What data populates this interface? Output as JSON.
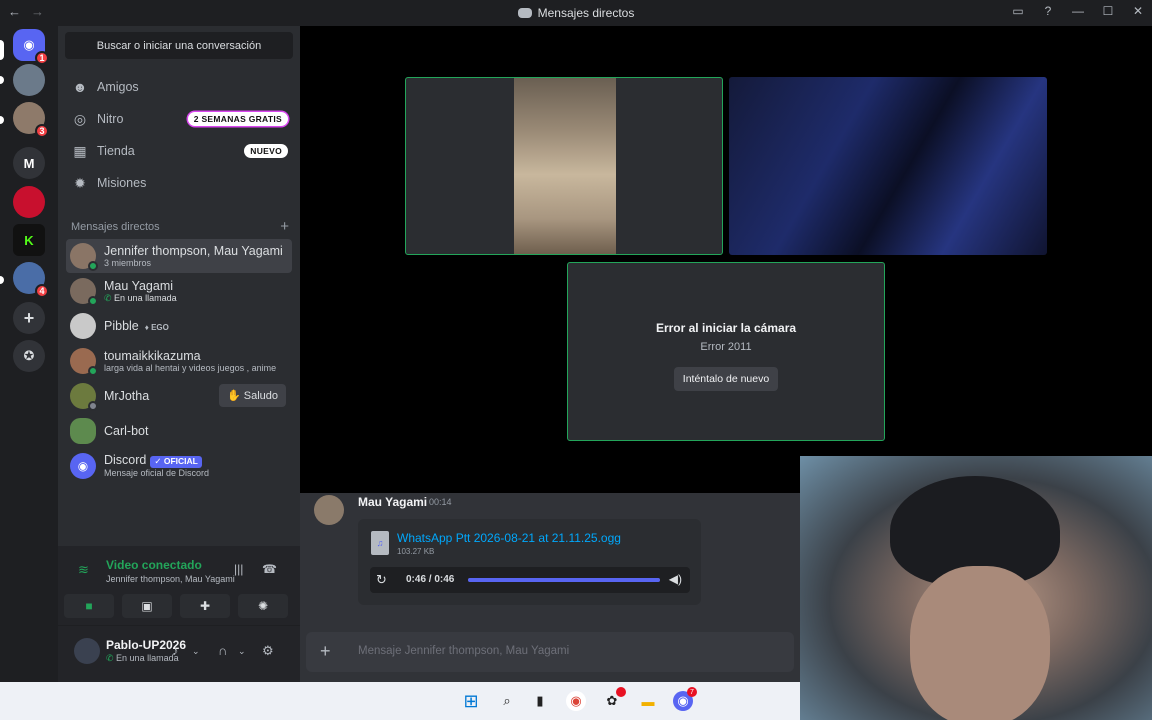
{
  "window": {
    "title": "Mensajes directos",
    "back": "←",
    "forward": "→"
  },
  "servers": [
    {
      "name": "Direct messages",
      "badge": "1"
    },
    {
      "name": "Group server"
    },
    {
      "name": "Server",
      "badge": "3"
    },
    {
      "name": "M"
    },
    {
      "name": "Server red"
    },
    {
      "name": "Kick"
    },
    {
      "name": "Server game",
      "badge": "4"
    }
  ],
  "dm_panel": {
    "search_placeholder": "Buscar o iniciar una conversación",
    "nav": [
      {
        "label": "Amigos"
      },
      {
        "label": "Nitro",
        "tag": "2 SEMANAS GRATIS"
      },
      {
        "label": "Tienda",
        "tag": "NUEVO"
      },
      {
        "label": "Misiones"
      }
    ],
    "section_title": "Mensajes directos",
    "section_add": "+",
    "dms": [
      {
        "name": "Jennifer thompson, Mau Yagami",
        "sub": "3 miembros"
      },
      {
        "name": "Mau Yagami",
        "sub": "En una llamada"
      },
      {
        "name": "Pibble",
        "badge": "EGO"
      },
      {
        "name": "toumaikkikazuma",
        "sub": "larga vida al hentai y videos juegos , anime"
      },
      {
        "name": "MrJotha",
        "action": "Saludo"
      },
      {
        "name": "Carl-bot"
      },
      {
        "name": "Discord",
        "badge": "OFICIAL",
        "sub": "Mensaje oficial de Discord"
      }
    ]
  },
  "voice": {
    "status": "Video conectado",
    "channel": "Jennifer thompson, Mau Yagami"
  },
  "user": {
    "name": "Pablo-UP2026",
    "status": "En una llamada"
  },
  "stage": {
    "error_title": "Error al iniciar la cámara",
    "error_code": "Error 2011",
    "retry_label": "Inténtalo de nuevo"
  },
  "chat": {
    "author": "Mau Yagami",
    "time": "00:14",
    "file_name": "WhatsApp Ptt 2026-08-21 at 21.11.25.ogg",
    "file_size": "103.27 KB",
    "player_time": "0:46 / 0:46",
    "progress": 1.0,
    "composer_placeholder": "Mensaje Jennifer thompson, Mau Yagami"
  },
  "taskbar": {
    "discord_badge": "7"
  },
  "colors": {
    "accent": "#5865f2",
    "online": "#23a55a",
    "link": "#00a8fc"
  }
}
